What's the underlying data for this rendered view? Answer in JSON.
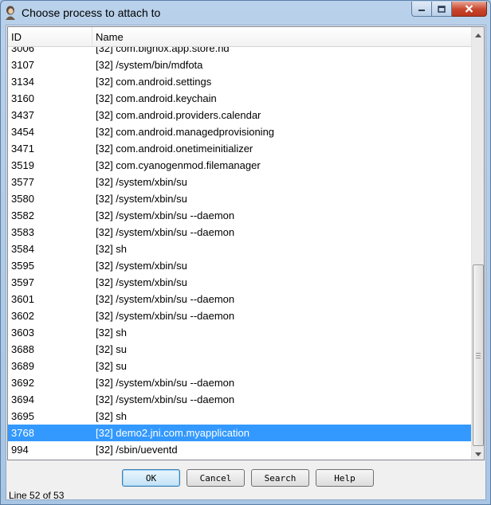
{
  "window": {
    "title": "Choose process to attach to",
    "accent_color": "#3399ff"
  },
  "table": {
    "columns": [
      "ID",
      "Name"
    ],
    "rows": [
      {
        "id": "3006",
        "name": "[32] com.bignox.app.store.hd"
      },
      {
        "id": "3107",
        "name": "[32] /system/bin/mdfota"
      },
      {
        "id": "3134",
        "name": "[32] com.android.settings"
      },
      {
        "id": "3160",
        "name": "[32] com.android.keychain"
      },
      {
        "id": "3437",
        "name": "[32] com.android.providers.calendar"
      },
      {
        "id": "3454",
        "name": "[32] com.android.managedprovisioning"
      },
      {
        "id": "3471",
        "name": "[32] com.android.onetimeinitializer"
      },
      {
        "id": "3519",
        "name": "[32] com.cyanogenmod.filemanager"
      },
      {
        "id": "3577",
        "name": "[32] /system/xbin/su"
      },
      {
        "id": "3580",
        "name": "[32] /system/xbin/su"
      },
      {
        "id": "3582",
        "name": "[32] /system/xbin/su --daemon"
      },
      {
        "id": "3583",
        "name": "[32] /system/xbin/su --daemon"
      },
      {
        "id": "3584",
        "name": "[32] sh"
      },
      {
        "id": "3595",
        "name": "[32] /system/xbin/su"
      },
      {
        "id": "3597",
        "name": "[32] /system/xbin/su"
      },
      {
        "id": "3601",
        "name": "[32] /system/xbin/su --daemon"
      },
      {
        "id": "3602",
        "name": "[32] /system/xbin/su --daemon"
      },
      {
        "id": "3603",
        "name": "[32] sh"
      },
      {
        "id": "3688",
        "name": "[32] su"
      },
      {
        "id": "3689",
        "name": "[32] su"
      },
      {
        "id": "3692",
        "name": "[32] /system/xbin/su --daemon"
      },
      {
        "id": "3694",
        "name": "[32] /system/xbin/su --daemon"
      },
      {
        "id": "3695",
        "name": "[32] sh"
      },
      {
        "id": "3768",
        "name": "[32] demo2.jni.com.myapplication",
        "selected": true
      },
      {
        "id": "994",
        "name": "[32] /sbin/ueventd"
      }
    ]
  },
  "buttons": {
    "ok": "OK",
    "cancel": "Cancel",
    "search": "Search",
    "help": "Help"
  },
  "status": {
    "text": "Line 52 of 53"
  },
  "icons": {
    "title": "person-icon",
    "minimize": "minimize-icon",
    "maximize": "maximize-icon",
    "close": "close-icon",
    "scroll_up": "chevron-up-icon",
    "scroll_down": "chevron-down-icon"
  }
}
